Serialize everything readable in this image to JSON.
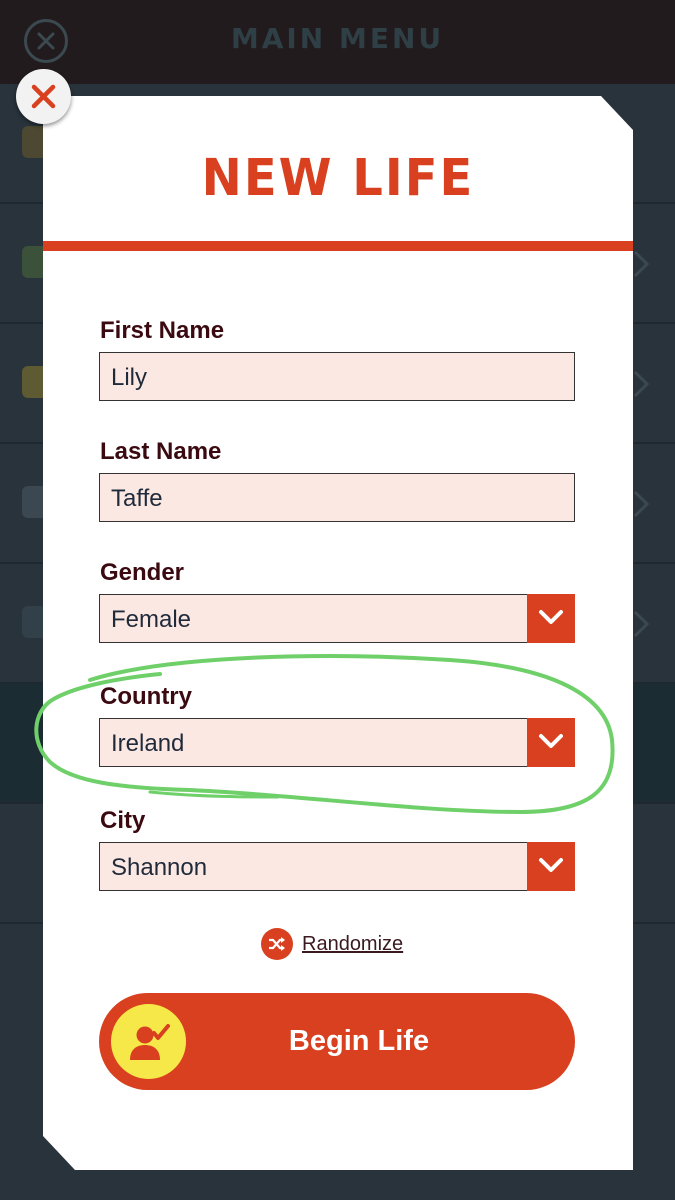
{
  "background": {
    "title": "MAIN MENU"
  },
  "modal": {
    "title": "NEW LIFE",
    "fields": {
      "first_name": {
        "label": "First Name",
        "value": "Lily"
      },
      "last_name": {
        "label": "Last Name",
        "value": "Taffe"
      },
      "gender": {
        "label": "Gender",
        "value": "Female"
      },
      "country": {
        "label": "Country",
        "value": "Ireland"
      },
      "city": {
        "label": "City",
        "value": "Shannon"
      }
    },
    "randomize_label": "Randomize",
    "begin_label": "Begin Life"
  },
  "icons": {
    "close": "close-icon",
    "dropdown": "chevron-down-icon",
    "randomize": "shuffle-icon",
    "begin": "person-check-icon"
  },
  "colors": {
    "accent": "#d8401f",
    "field_bg": "#fce8e3",
    "label": "#3a0a10",
    "begin_icon_bg": "#f7e84a",
    "annotation": "#6fd06a"
  }
}
